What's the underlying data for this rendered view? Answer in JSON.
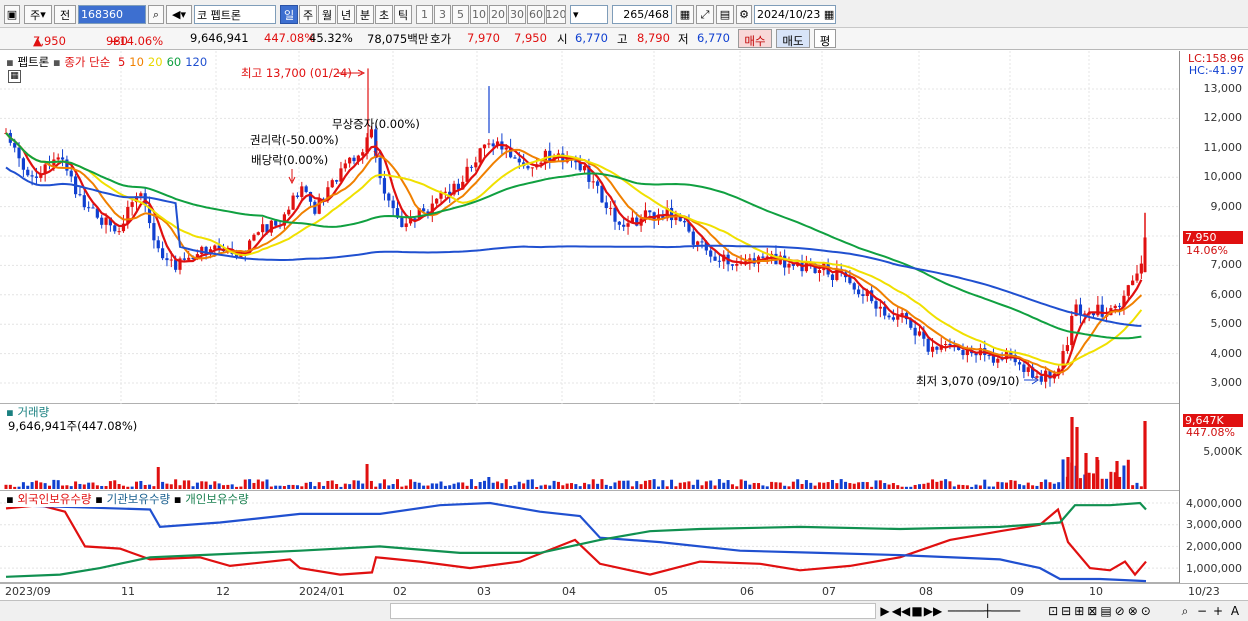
{
  "toolbar": {
    "market": "주",
    "prev": "전",
    "code": "168360",
    "name_prefix": "코",
    "stock_name": "펩트론",
    "periods": [
      "일",
      "주",
      "월",
      "년",
      "분",
      "초",
      "틱"
    ],
    "active_period": "일",
    "counts": [
      "1",
      "3",
      "5",
      "10",
      "20",
      "30",
      "60",
      "120"
    ],
    "range": "265",
    "range_total": "/468",
    "date": "2024/10/23"
  },
  "quote": {
    "price": "7,950",
    "arrow": "▲",
    "change": "980",
    "change_pct": "+14.06%",
    "volume": "9,646,941",
    "vol_pct": "447.08%",
    "turnover": "45.32%",
    "amount": "78,075백만",
    "bid_lbl": "호가",
    "bid": "7,970",
    "ask": "7,950",
    "open_lbl": "시",
    "open": "6,770",
    "high_lbl": "고",
    "high": "8,790",
    "low_lbl": "저",
    "low": "6,770",
    "buy": "매수",
    "sell": "매도",
    "avg": "평"
  },
  "price_chart": {
    "stock_name": "펩트론",
    "series_lbl": "종가 단순",
    "ma": [
      {
        "p": "5",
        "c": "#e01010"
      },
      {
        "p": "10",
        "c": "#f08000"
      },
      {
        "p": "20",
        "c": "#e8d800"
      },
      {
        "p": "60",
        "c": "#10a040"
      },
      {
        "p": "120",
        "c": "#2050d0"
      }
    ],
    "lc": "LC:158.96",
    "hc": "HC:-41.97",
    "ann_high": "최고 13,700 (01/24)",
    "ann_low": "최저 3,070 (09/10)",
    "ann_rights": "권리락(-50.00%)",
    "ann_div": "배당락(0.00%)",
    "ann_bonus": "무상증자(0.00%)",
    "yaxis": [
      "13,000",
      "12,000",
      "11,000",
      "10,000",
      "9,000",
      "8,000",
      "7,000",
      "6,000",
      "5,000",
      "4,000",
      "3,000"
    ],
    "last": "7,950",
    "last_pct": "14.06%"
  },
  "volume_chart": {
    "title": "거래량",
    "value": "9,646,941주(447.08%)",
    "yaxis": [
      "5,000K"
    ],
    "last": "9,647K",
    "last_pct": "447.08%"
  },
  "holdings_chart": {
    "foreign": "외국인보유수량",
    "inst": "기관보유수량",
    "indiv": "개인보유수량",
    "yaxis": [
      "4,000,000",
      "3,000,000",
      "2,000,000",
      "1,000,000"
    ]
  },
  "dates": [
    "2023/09",
    "11",
    "12",
    "2024/01",
    "02",
    "03",
    "04",
    "05",
    "06",
    "07",
    "08",
    "09",
    "10"
  ],
  "date_last": "10/23",
  "chart_data": [
    {
      "type": "line",
      "title": "",
      "x": [
        "2023/09",
        "2023/10",
        "2023/11",
        "2023/12",
        "2024/01",
        "2024/02",
        "2024/03",
        "2024/04",
        "2024/05",
        "2024/06",
        "2024/07",
        "2024/08",
        "2024/09",
        "2024/10"
      ],
      "series": [
        {
          "name": "종가",
          "values": [
            11500,
            9800,
            7200,
            7800,
            10500,
            8600,
            10800,
            10400,
            8200,
            7000,
            6900,
            4200,
            3200,
            7950
          ]
        }
      ],
      "ylim": [
        2500,
        13700
      ]
    },
    {
      "type": "bar",
      "title": "거래량",
      "values": [
        9646941
      ]
    },
    {
      "type": "line",
      "title": "",
      "series": [
        {
          "name": "외국인보유수량",
          "values": [
            3800000,
            1900000,
            1400000,
            1100000,
            900000,
            1600000,
            1100000,
            2300000,
            1200000,
            1100000,
            900000,
            1800000,
            3500000,
            1200000
          ]
        },
        {
          "name": "기관보유수량",
          "values": [
            3900000,
            3700000,
            3400000,
            3600000,
            3700000,
            3800000,
            3600000,
            2400000,
            1800000,
            1700000,
            1600000,
            1400000,
            700000,
            600000
          ]
        },
        {
          "name": "개인보유수량",
          "values": [
            600000,
            1200000,
            1500000,
            1600000,
            1700000,
            1700000,
            1900000,
            2300000,
            2700000,
            2800000,
            2800000,
            2900000,
            3100000,
            3800000
          ]
        }
      ],
      "ylim": [
        0,
        4400000
      ]
    }
  ]
}
